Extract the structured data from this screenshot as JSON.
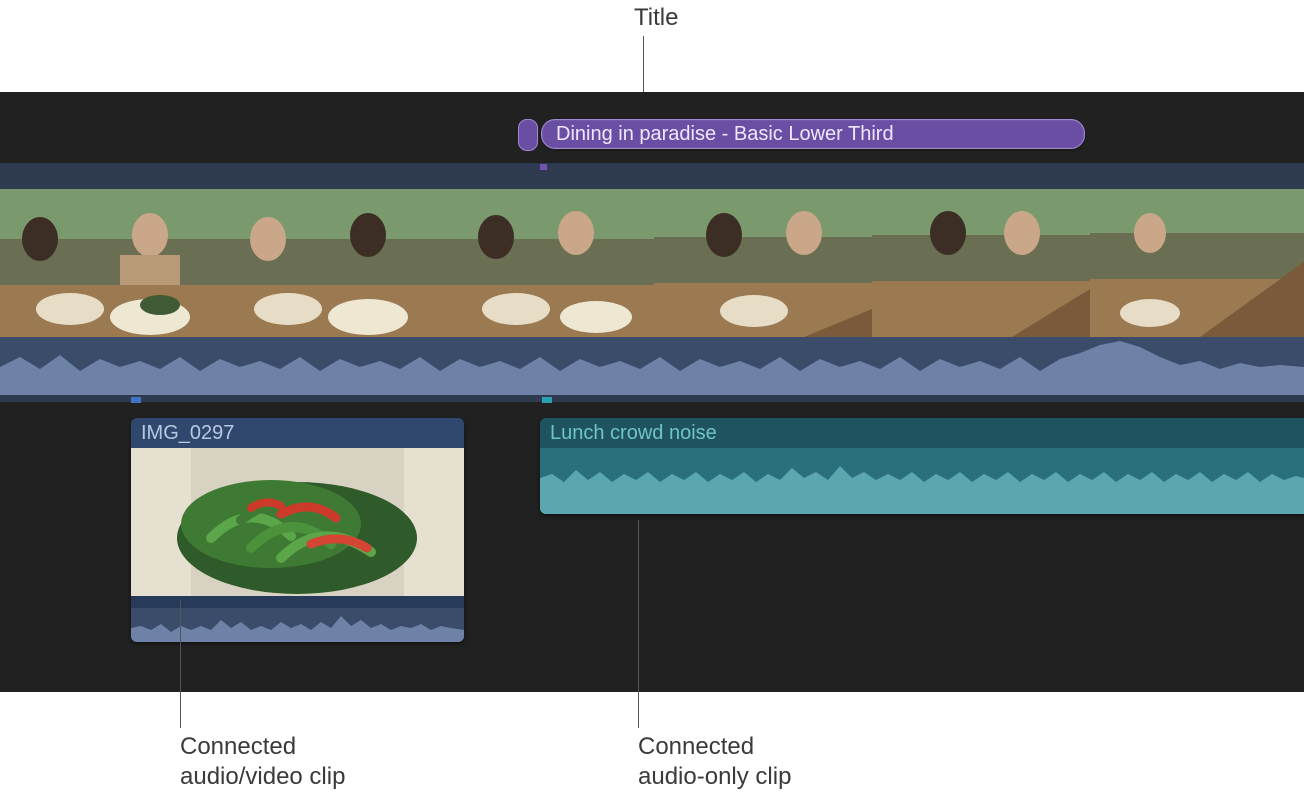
{
  "annotations": {
    "title": "Title",
    "connected_av": "Connected\naudio/video clip",
    "connected_audio_only": "Connected\naudio-only clip"
  },
  "timeline": {
    "title_clip_label": "Dining in paradise - Basic Lower Third",
    "main_clip_name": "",
    "av_clip_label": "IMG_0297",
    "audio_clip_label": "Lunch crowd noise",
    "thumb_count": 7
  },
  "colors": {
    "title_purple": "#6a4ea3",
    "title_border": "#a189d0",
    "storyline_bg": "#2d3a50",
    "audio_bg": "#3b4b6a",
    "av_title_bg": "#31486e",
    "audio_clip_title_bg": "#1f535f",
    "audio_clip_wave": "#2a6f7c"
  }
}
